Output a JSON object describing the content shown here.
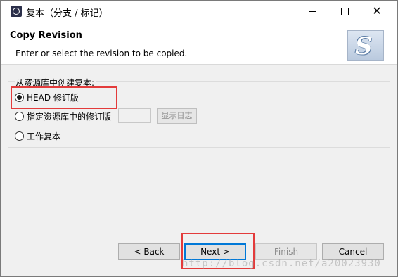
{
  "window": {
    "title": "复本（分支 / 标记）",
    "controls": {
      "minimize": "–",
      "maximize": "□",
      "close": "✕"
    }
  },
  "header": {
    "title": "Copy Revision",
    "description": "Enter or select the revision to be copied.",
    "logo_icon": "subversive-logo"
  },
  "group": {
    "label": "从资源库中创建复本:",
    "options": [
      {
        "label": "HEAD 修订版",
        "checked": true
      },
      {
        "label": "指定资源库中的修订版",
        "checked": false
      },
      {
        "label": "工作复本",
        "checked": false
      }
    ],
    "revision_input_value": "",
    "show_log_label": "显示日志"
  },
  "footer": {
    "back_label": "< Back",
    "next_label": "Next >",
    "finish_label": "Finish",
    "cancel_label": "Cancel"
  },
  "watermark": "http://blog.csdn.net/a20023930",
  "colors": {
    "highlight": "#e33b3b",
    "focus": "#0078d7"
  }
}
